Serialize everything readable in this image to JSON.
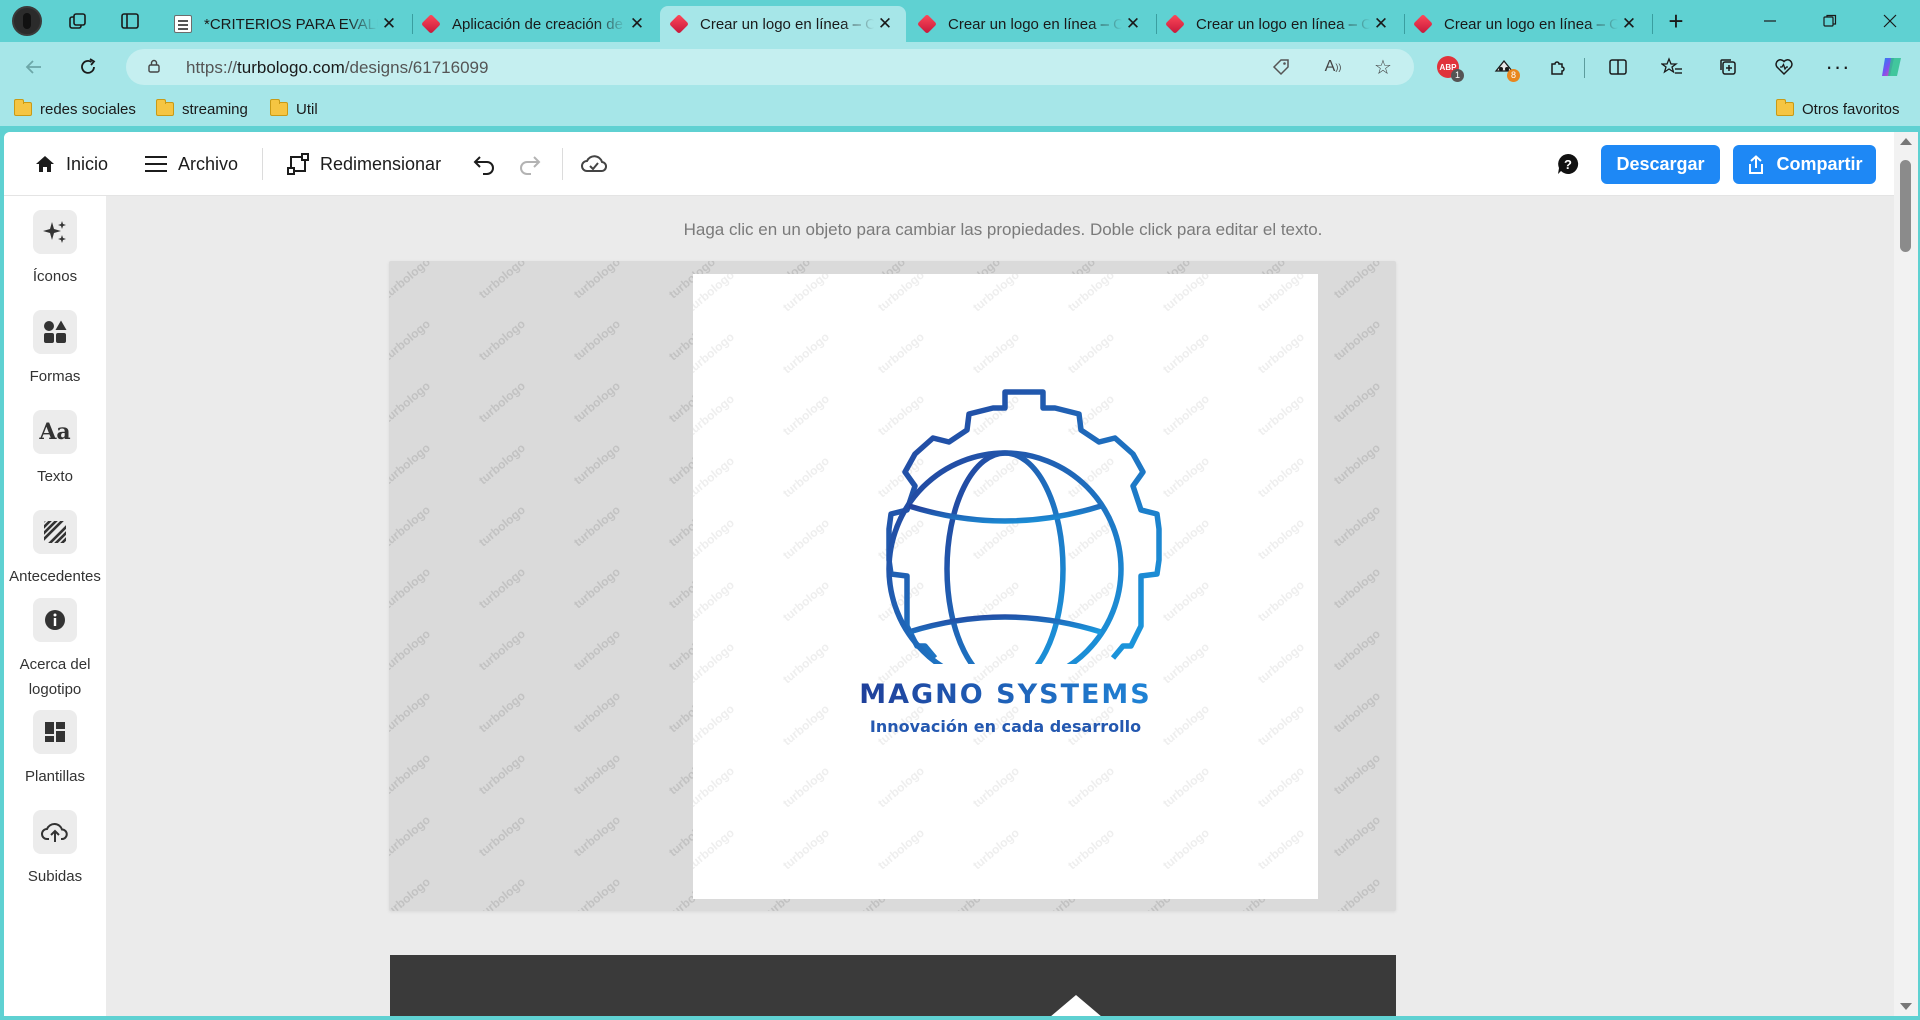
{
  "browser": {
    "tabs": [
      {
        "title": "*CRITERIOS PARA EVALUAR",
        "favicon": "document-icon",
        "active": false
      },
      {
        "title": "Aplicación de creación de logos",
        "favicon": "turbologo-icon",
        "active": false
      },
      {
        "title": "Crear un logo en línea – Crear",
        "favicon": "turbologo-icon",
        "active": true
      },
      {
        "title": "Crear un logo en línea – Crear",
        "favicon": "turbologo-icon",
        "active": false
      },
      {
        "title": "Crear un logo en línea – Crear",
        "favicon": "turbologo-icon",
        "active": false
      },
      {
        "title": "Crear un logo en línea – Crear",
        "favicon": "turbologo-icon",
        "active": false
      }
    ],
    "url_prefix": "https://",
    "url_domain": "turbologo.com",
    "url_path": "/designs/61716099",
    "extensions": {
      "adblock_badge": "1",
      "adblock_label": "ABP",
      "second_badge": "8"
    },
    "bookmarks": [
      "redes sociales",
      "streaming",
      "Util"
    ],
    "other_favorites": "Otros favoritos"
  },
  "toolbar": {
    "home": "Inicio",
    "file": "Archivo",
    "resize": "Redimensionar",
    "download": "Descargar",
    "share": "Compartir"
  },
  "sidebar": {
    "items": [
      {
        "label": "Íconos",
        "icon": "sparkles-icon"
      },
      {
        "label": "Formas",
        "icon": "shapes-icon"
      },
      {
        "label": "Texto",
        "icon": "text-icon",
        "glyph": "Aa"
      },
      {
        "label": "Antecedentes",
        "icon": "stripes-icon"
      },
      {
        "label": "Acerca del logotipo",
        "icon": "info-icon"
      },
      {
        "label": "Plantillas",
        "icon": "templates-icon"
      },
      {
        "label": "Subidas",
        "icon": "upload-cloud-icon"
      }
    ]
  },
  "canvas": {
    "hint": "Haga clic en un objeto para cambiar las propiedades. Doble click para editar el texto.",
    "watermark": "turbologo",
    "logo": {
      "name": "MAGNO SYSTEMS",
      "tagline": "Innovación en cada desarrollo",
      "color_start": "#233f9a",
      "color_end": "#1a9be0"
    }
  },
  "colors": {
    "browser_frame": "#5fd1d2",
    "browser_active": "#a6e6e8",
    "primary_button": "#1e88f5"
  }
}
